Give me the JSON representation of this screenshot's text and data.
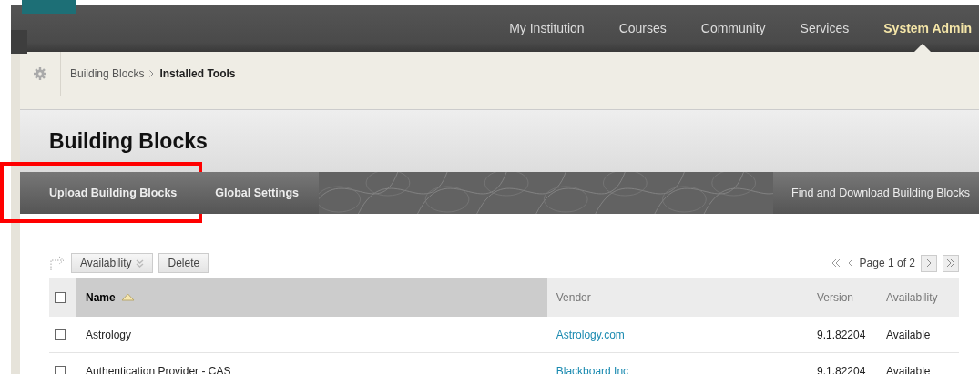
{
  "top_nav": [
    {
      "label": "My Institution",
      "selected": false
    },
    {
      "label": "Courses",
      "selected": false
    },
    {
      "label": "Community",
      "selected": false
    },
    {
      "label": "Services",
      "selected": false
    },
    {
      "label": "System Admin",
      "selected": true
    }
  ],
  "breadcrumb": {
    "parent": "Building Blocks",
    "current": "Installed Tools"
  },
  "page_title": "Building Blocks",
  "action_bar": {
    "left": [
      {
        "label": "Upload Building Blocks",
        "highlighted": true
      },
      {
        "label": "Global Settings",
        "highlighted": false
      }
    ],
    "right": "Find and Download Building Blocks"
  },
  "list_actions": {
    "buttons": [
      {
        "label": "Availability",
        "kind": "menu"
      },
      {
        "label": "Delete",
        "kind": "plain"
      }
    ],
    "page_label": "Page 1 of 2"
  },
  "table": {
    "select_all_checked": false,
    "columns": [
      {
        "label": "Name",
        "sorted": true
      },
      {
        "label": "Vendor",
        "sorted": false
      },
      {
        "label": "Version",
        "sorted": false
      },
      {
        "label": "Availability",
        "sorted": false
      }
    ],
    "rows": [
      {
        "checked": false,
        "name": "Astrology",
        "vendor": "Astrology.com",
        "version": "9.1.82204",
        "availability": "Available"
      },
      {
        "checked": false,
        "name": "Authentication Provider - CAS",
        "vendor": "Blackboard Inc",
        "version": "9.1.82204",
        "availability": "Available"
      }
    ]
  }
}
